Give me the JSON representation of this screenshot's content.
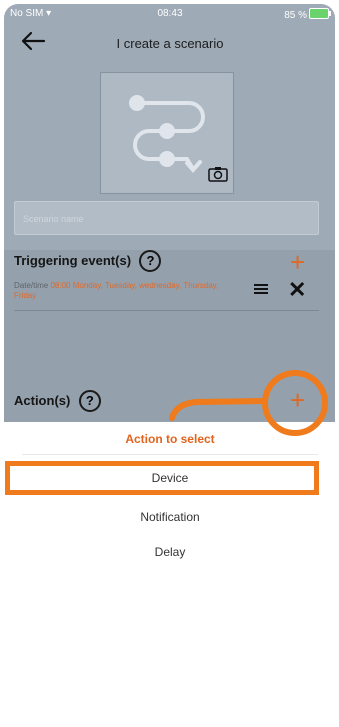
{
  "status_bar": {
    "carrier": "No SIM",
    "time": "08:43",
    "battery": "85 %"
  },
  "header": {
    "title": "I create a scenario"
  },
  "scenario_name": {
    "placeholder": "Scenario name"
  },
  "triggering": {
    "title": "Triggering event(s)",
    "help": "?",
    "add": "+",
    "item": {
      "label": "Date/time",
      "time": "08:00",
      "days": "Monday, Tuesday, wednesday, Thursday, Friday"
    },
    "remove": "✕"
  },
  "actions": {
    "title": "Action(s)",
    "help": "?",
    "add": "+"
  },
  "action_sheet": {
    "title": "Action to select",
    "options": [
      "Device",
      "Notification",
      "Delay"
    ]
  },
  "colors": {
    "accent": "#e06820",
    "highlight": "#ef7b1c",
    "dim_overlay": "#9eaab6"
  }
}
